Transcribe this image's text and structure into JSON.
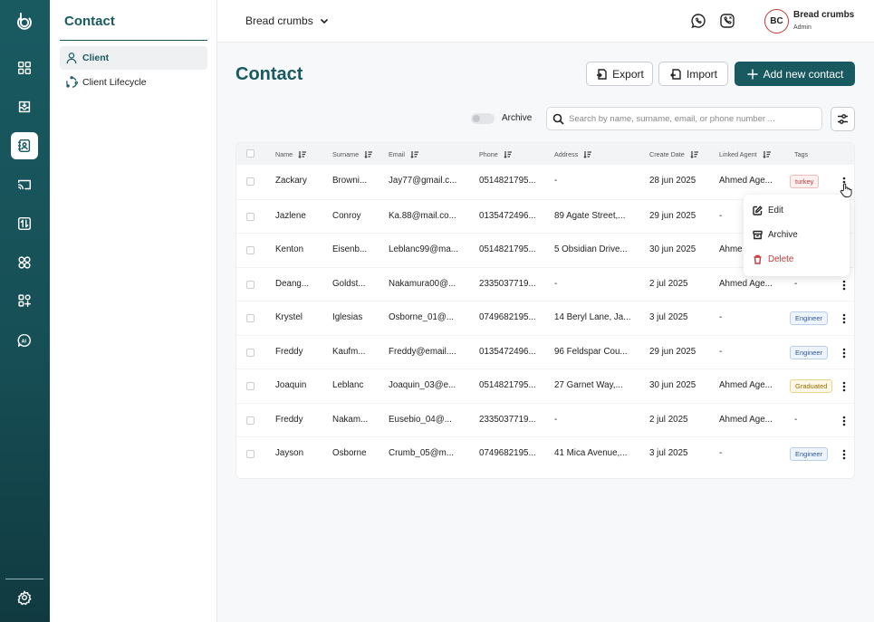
{
  "sidebar_title": "Contact",
  "sidebar_items": [
    {
      "label": "Client",
      "icon": "user-icon",
      "active": true
    },
    {
      "label": "Client Lifecycle",
      "icon": "cycle-icon",
      "active": false
    }
  ],
  "rail_icons": [
    "logo-icon",
    "dashboard-icon",
    "inbox-icon",
    "contacts-icon",
    "cast-icon",
    "transfer-icon",
    "apps-icon",
    "add-apps-icon",
    "ai-icon",
    "settings-icon"
  ],
  "topbar": {
    "breadcrumb": "Bread crumbs",
    "user_initials": "BC",
    "user_name": "Bread crumbs",
    "user_role": "Admin"
  },
  "page_title": "Contact",
  "actions": {
    "export": "Export",
    "import": "Import",
    "add": "Add new contact"
  },
  "archive_toggle_label": "Archive",
  "search_placeholder": "Search by name, surname, email, or phone number ...",
  "table": {
    "columns": [
      "Name",
      "Surname",
      "Email",
      "Phone",
      "Address",
      "Create Date",
      "Linked Agent",
      "Tags"
    ],
    "rows": [
      {
        "name": "Zackary",
        "surname": "Browni...",
        "email": "Jay77@gmail.c...",
        "phone": "0514821795...",
        "address": "-",
        "date": "28 jun 2025",
        "agent": "Ahmed Age...",
        "tag": "turkey"
      },
      {
        "name": "Jazlene",
        "surname": "Conroy",
        "email": "Ka.88@mail.co...",
        "phone": "0135472496...",
        "address": "89 Agate Street,...",
        "date": "29 jun 2025",
        "agent": "-",
        "tag": ""
      },
      {
        "name": "Kenton",
        "surname": "Eisenb...",
        "email": "Leblanc99@ma...",
        "phone": "0514821795...",
        "address": "5 Obsidian Drive...",
        "date": "30 jun 2025",
        "agent": "Ahme",
        "tag": ""
      },
      {
        "name": "Deang...",
        "surname": "Goldst...",
        "email": "Nakamura00@...",
        "phone": "2335037719...",
        "address": "-",
        "date": "2 jul 2025",
        "agent": "Ahmed Age...",
        "tag": "-"
      },
      {
        "name": "Krystel",
        "surname": "Iglesias",
        "email": "Osborne_01@...",
        "phone": "0749682195...",
        "address": "14 Beryl Lane, Ja...",
        "date": "3 jul 2025",
        "agent": "-",
        "tag": "Engineer"
      },
      {
        "name": "Freddy",
        "surname": "Kaufm...",
        "email": "Freddy@email....",
        "phone": "0135472496...",
        "address": "96 Feldspar Cou...",
        "date": "29 jun 2025",
        "agent": "-",
        "tag": "Engineer"
      },
      {
        "name": "Joaquin",
        "surname": "Leblanc",
        "email": "Joaquin_03@e...",
        "phone": "0514821795...",
        "address": "27 Garnet Way,...",
        "date": "30 jun 2025",
        "agent": "Ahmed Age...",
        "tag": "Graduated"
      },
      {
        "name": "Freddy",
        "surname": "Nakam...",
        "email": "Eusebio_04@...",
        "phone": "2335037719...",
        "address": "-",
        "date": "2 jul 2025",
        "agent": "Ahmed Age...",
        "tag": "-"
      },
      {
        "name": "Jayson",
        "surname": "Osborne",
        "email": "Crumb_05@m...",
        "phone": "0749682195...",
        "address": "41 Mica Avenue,...",
        "date": "3 jul 2025",
        "agent": "-",
        "tag": "Engineer"
      }
    ]
  },
  "tag_styles": {
    "turkey": {
      "color": "#c0393b",
      "bg": "#fdf0f0",
      "border": "#f1b9b9"
    },
    "Engineer": {
      "color": "#2f5a96",
      "bg": "#eef4fc",
      "border": "#b9cdec"
    },
    "Graduated": {
      "color": "#9a6a00",
      "bg": "#fdf7e6",
      "border": "#ebd38d"
    }
  },
  "row_menu": {
    "edit": "Edit",
    "archive": "Archive",
    "delete": "Delete"
  },
  "colors": {
    "brand": "#195a61",
    "danger": "#c0393b"
  }
}
